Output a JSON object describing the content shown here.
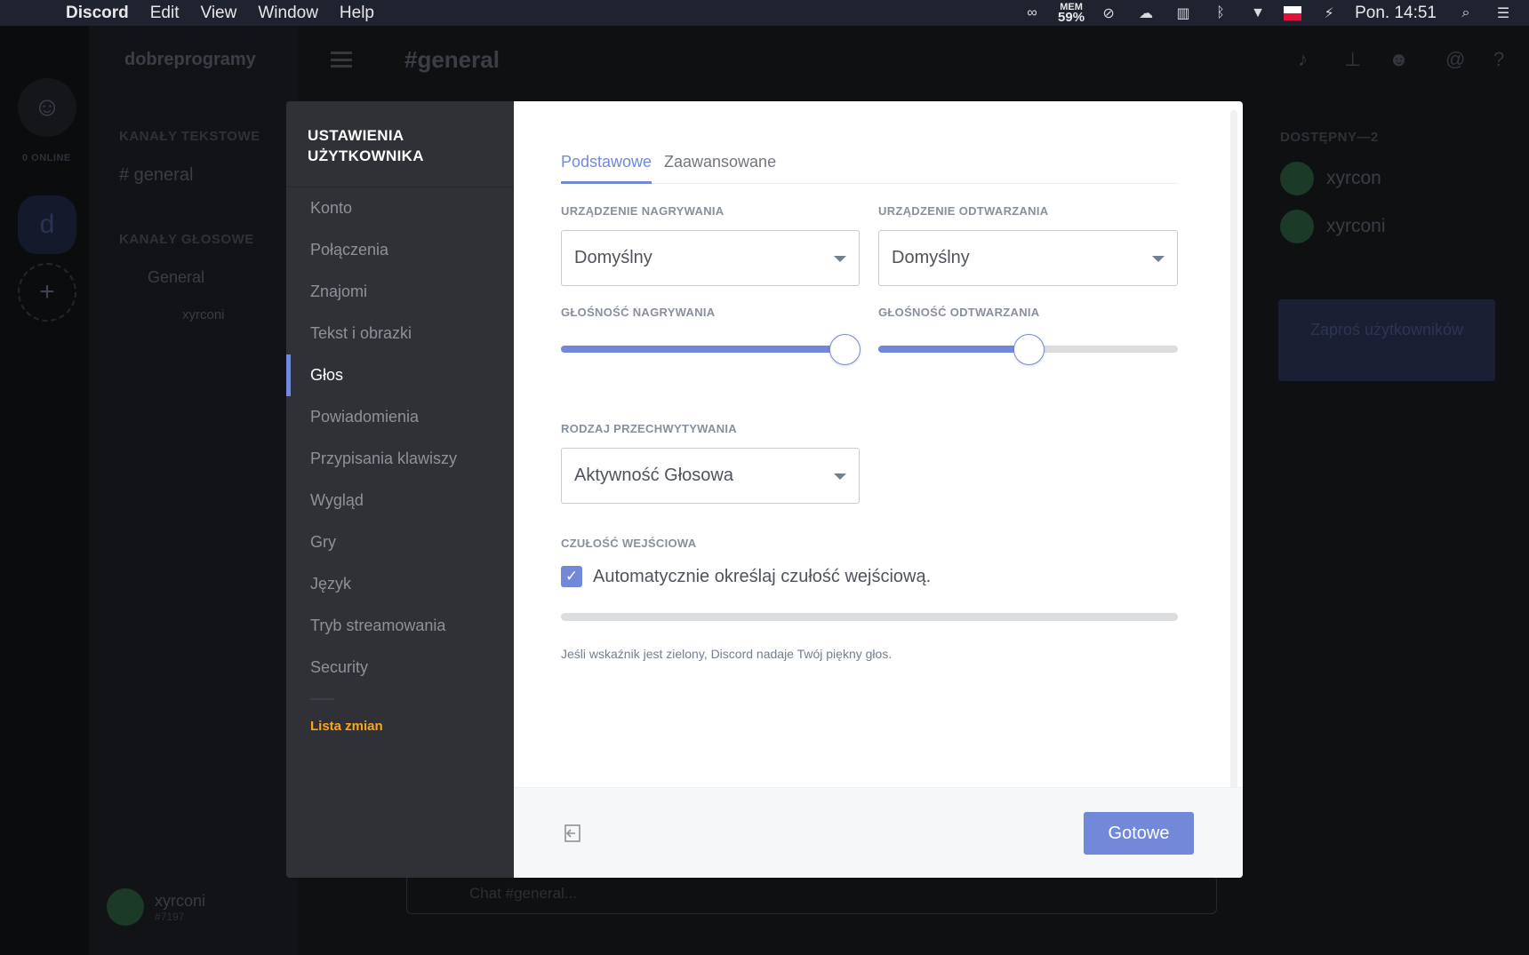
{
  "menubar": {
    "app_name": "Discord",
    "menus": [
      "Edit",
      "View",
      "Window",
      "Help"
    ],
    "mem_label": "MEM",
    "mem_value": "59%",
    "clock": "Pon. 14:51"
  },
  "background": {
    "server_name": "dobreprogramy",
    "channel_title": "#general",
    "online_count": "0 ONLINE",
    "guild_letter": "d",
    "text_channels_header": "KANAŁY TEKSTOWE",
    "text_channel": "# general",
    "voice_channels_header": "KANAŁY GŁOSOWE",
    "voice_channel": "General",
    "voice_user": "xyrconi",
    "members_header": "DOSTĘPNY—2",
    "members": [
      "xyrcon",
      "xyrconi"
    ],
    "invite_button": "Zaproś użytkowników",
    "chat_placeholder": "Chat #general...",
    "user_name": "xyrconi",
    "user_tag": "#7197"
  },
  "settings": {
    "title": "USTAWIENIA UŻYTKOWNIKA",
    "nav": [
      {
        "label": "Konto"
      },
      {
        "label": "Połączenia"
      },
      {
        "label": "Znajomi"
      },
      {
        "label": "Tekst i obrazki"
      },
      {
        "label": "Głos"
      },
      {
        "label": "Powiadomienia"
      },
      {
        "label": "Przypisania klawiszy"
      },
      {
        "label": "Wygląd"
      },
      {
        "label": "Gry"
      },
      {
        "label": "Język"
      },
      {
        "label": "Tryb streamowania"
      },
      {
        "label": "Security"
      }
    ],
    "active_nav": "Głos",
    "changelog": "Lista zmian",
    "tabs": {
      "basic": "Podstawowe",
      "advanced": "Zaawansowane"
    },
    "input_device_label": "URZĄDZENIE NAGRYWANIA",
    "input_device_value": "Domyślny",
    "output_device_label": "URZĄDZENIE ODTWARZANIA",
    "output_device_value": "Domyślny",
    "input_volume_label": "GŁOŚNOŚĆ NAGRYWANIA",
    "input_volume": 0.95,
    "output_volume_label": "GŁOŚNOŚĆ ODTWARZANIA",
    "output_volume": 0.5,
    "input_mode_label": "RODZAJ PRZECHWYTYWANIA",
    "input_mode_value": "Aktywność Głosowa",
    "sensitivity_label": "CZUŁOŚĆ WEJŚCIOWA",
    "auto_sensitivity_label": "Automatycznie określaj czułość wejściową.",
    "auto_sensitivity_checked": true,
    "hint": "Jeśli wskaźnik jest zielony, Discord nadaje Twój piękny głos.",
    "done_button": "Gotowe"
  },
  "colors": {
    "accent": "#7289da",
    "changelog": "#faa61a",
    "sidebar": "#2f3136"
  }
}
